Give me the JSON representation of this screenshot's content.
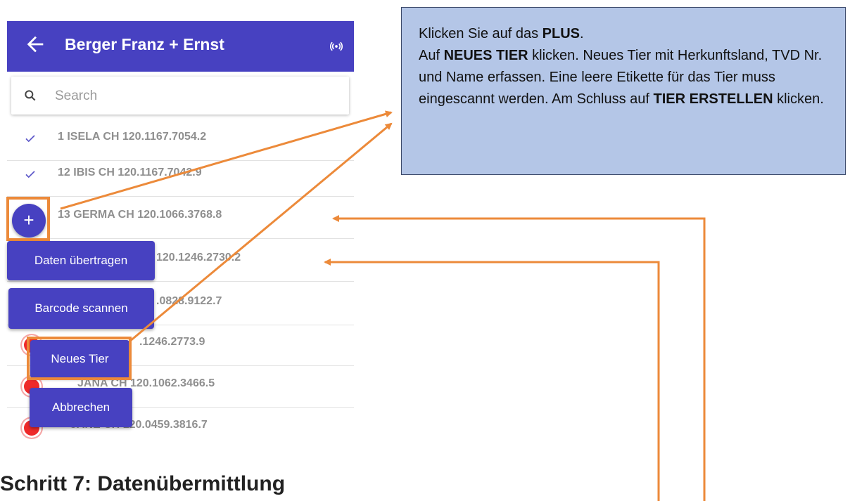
{
  "app": {
    "title": "Berger Franz + Ernst",
    "icons": {
      "back": "arrow-left-icon",
      "signal": "signal-icon",
      "search": "search-icon"
    }
  },
  "search": {
    "placeholder": "Search",
    "value": ""
  },
  "list": {
    "items": [
      {
        "label": "1 ISELA CH 120.1167.7054.2",
        "status": "check"
      },
      {
        "label": "12 IBIS CH 120.1167.7042.9",
        "status": "check"
      },
      {
        "label": "13 GERMA CH 120.1066.3768.8",
        "status": "none"
      },
      {
        "label": "120.1246.2730.2",
        "status": "none"
      },
      {
        "label": ".0828.9122.7",
        "status": "none"
      },
      {
        "label": ".1246.2773.9",
        "status": "red"
      },
      {
        "label": "JANA CH 120.1062.3466.5",
        "status": "red"
      },
      {
        "label": "JANE CH 120.0459.3816.7",
        "status": "red"
      }
    ]
  },
  "fab": {
    "label": "+"
  },
  "actions": {
    "daten": "Daten übertragen",
    "barcode": "Barcode scannen",
    "neues_tier": "Neues Tier",
    "abbrechen": "Abbrechen"
  },
  "callout": {
    "line1_pre": "Klicken Sie auf das ",
    "line1_bold": "PLUS",
    "line1_post": ".",
    "line2_pre": "Auf ",
    "line2_bold": "NEUES TIER",
    "line2_post": " klicken. Neues Tier mit Herkunftsland, TVD Nr. und Name erfassen. Eine leere Etikette für das Tier muss eingescannt werden. Am Schluss auf ",
    "line2_bold2": "TIER ERSTELLEN",
    "line2_end": " klicken."
  },
  "heading": "Schritt 7: Datenübermittlung",
  "colors": {
    "primary": "#4741c1",
    "highlight": "#ec8a3a",
    "callout_bg": "#b4c6e7",
    "status_red": "#ee2a2a"
  }
}
